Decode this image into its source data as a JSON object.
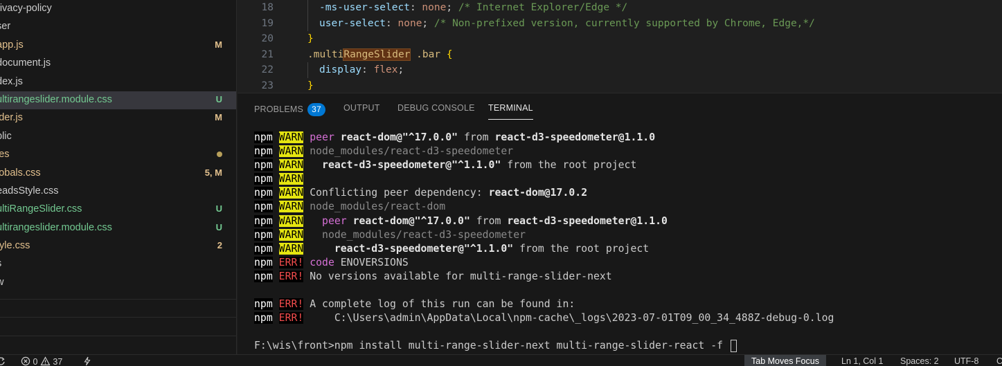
{
  "explorer": {
    "files": [
      {
        "name": "rivacy-policy",
        "status": "",
        "type": "default"
      },
      {
        "name": "ser",
        "status": "",
        "type": "default"
      },
      {
        "name": "app.js",
        "status": "M",
        "type": "modified"
      },
      {
        "name": "document.js",
        "status": "",
        "type": "default"
      },
      {
        "name": "dex.js",
        "status": "",
        "type": "default"
      },
      {
        "name": "ultirangeslider.module.css",
        "status": "U",
        "type": "untracked",
        "selected": true
      },
      {
        "name": "ider.js",
        "status": "M",
        "type": "modified"
      },
      {
        "name": "blic",
        "status": "",
        "type": "default"
      },
      {
        "name": "les",
        "status": "",
        "type": "modified",
        "dot": true
      },
      {
        "name": "lobals.css",
        "status": "5, M",
        "type": "modified"
      },
      {
        "name": "eadsStyle.css",
        "status": "",
        "type": "default"
      },
      {
        "name": "ultiRangeSlider.css",
        "status": "U",
        "type": "untracked"
      },
      {
        "name": "ultirangeslider.module.css",
        "status": "U",
        "type": "untracked"
      },
      {
        "name": "tyle.css",
        "status": "2",
        "type": "modified"
      },
      {
        "name": "s",
        "status": "",
        "type": "default"
      },
      {
        "name": "w",
        "status": "",
        "type": "default"
      }
    ]
  },
  "editor": {
    "lines": [
      {
        "num": "18",
        "indent": 1,
        "tokens": [
          {
            "t": "-ms-user-select",
            "c": "prop"
          },
          {
            "t": ": ",
            "c": "punct"
          },
          {
            "t": "none",
            "c": "val"
          },
          {
            "t": "; ",
            "c": "punct"
          },
          {
            "t": "/* Internet Explorer/Edge */",
            "c": "com"
          }
        ]
      },
      {
        "num": "19",
        "indent": 1,
        "tokens": [
          {
            "t": "user-select",
            "c": "prop"
          },
          {
            "t": ": ",
            "c": "punct"
          },
          {
            "t": "none",
            "c": "val"
          },
          {
            "t": "; ",
            "c": "punct"
          },
          {
            "t": "/* Non-prefixed version, currently supported by Chrome, Edge,*/",
            "c": "com"
          }
        ]
      },
      {
        "num": "20",
        "indent": 0,
        "tokens": [
          {
            "t": "}",
            "c": "brace"
          }
        ]
      },
      {
        "num": "21",
        "indent": 0,
        "tokens": [
          {
            "t": ".multi",
            "c": "sel"
          },
          {
            "t": "RangeSlider",
            "c": "sel",
            "hl": true
          },
          {
            "t": " .bar ",
            "c": "sel"
          },
          {
            "t": "{",
            "c": "brace"
          }
        ]
      },
      {
        "num": "22",
        "indent": 1,
        "tokens": [
          {
            "t": "display",
            "c": "prop"
          },
          {
            "t": ": ",
            "c": "punct"
          },
          {
            "t": "flex",
            "c": "val"
          },
          {
            "t": ";",
            "c": "punct"
          }
        ]
      },
      {
        "num": "23",
        "indent": 0,
        "tokens": [
          {
            "t": "}",
            "c": "brace"
          }
        ]
      }
    ]
  },
  "panel": {
    "tabs": [
      {
        "label": "PROBLEMS",
        "badge": "37",
        "active": false
      },
      {
        "label": "OUTPUT",
        "active": false
      },
      {
        "label": "DEBUG CONSOLE",
        "active": false
      },
      {
        "label": "TERMINAL",
        "active": true
      }
    ]
  },
  "terminal": {
    "lines": [
      [
        {
          "t": "npm",
          "c": "npm"
        },
        {
          "t": " "
        },
        {
          "t": "WARN",
          "c": "warn"
        },
        {
          "t": " "
        },
        {
          "t": "peer",
          "c": "peer"
        },
        {
          "t": " "
        },
        {
          "t": "react-dom@\"^17.0.0\"",
          "c": "b"
        },
        {
          "t": " from "
        },
        {
          "t": "react-d3-speedometer@1.1.0",
          "c": "b"
        }
      ],
      [
        {
          "t": "npm",
          "c": "npm"
        },
        {
          "t": " "
        },
        {
          "t": "WARN",
          "c": "warn"
        },
        {
          "t": " "
        },
        {
          "t": "node_modules/react-d3-speedometer",
          "c": "dim"
        }
      ],
      [
        {
          "t": "npm",
          "c": "npm"
        },
        {
          "t": " "
        },
        {
          "t": "WARN",
          "c": "warn"
        },
        {
          "t": "   "
        },
        {
          "t": "react-d3-speedometer@\"^1.1.0\"",
          "c": "b"
        },
        {
          "t": " from the root project"
        }
      ],
      [
        {
          "t": "npm",
          "c": "npm"
        },
        {
          "t": " "
        },
        {
          "t": "WARN",
          "c": "warn"
        }
      ],
      [
        {
          "t": "npm",
          "c": "npm"
        },
        {
          "t": " "
        },
        {
          "t": "WARN",
          "c": "warn"
        },
        {
          "t": " Conflicting peer dependency: "
        },
        {
          "t": "react-dom@17.0.2",
          "c": "b"
        }
      ],
      [
        {
          "t": "npm",
          "c": "npm"
        },
        {
          "t": " "
        },
        {
          "t": "WARN",
          "c": "warn"
        },
        {
          "t": " "
        },
        {
          "t": "node_modules/react-dom",
          "c": "dim"
        }
      ],
      [
        {
          "t": "npm",
          "c": "npm"
        },
        {
          "t": " "
        },
        {
          "t": "WARN",
          "c": "warn"
        },
        {
          "t": "   "
        },
        {
          "t": "peer",
          "c": "peer"
        },
        {
          "t": " "
        },
        {
          "t": "react-dom@\"^17.0.0\"",
          "c": "b"
        },
        {
          "t": " from "
        },
        {
          "t": "react-d3-speedometer@1.1.0",
          "c": "b"
        }
      ],
      [
        {
          "t": "npm",
          "c": "npm"
        },
        {
          "t": " "
        },
        {
          "t": "WARN",
          "c": "warn"
        },
        {
          "t": "   "
        },
        {
          "t": "node_modules/react-d3-speedometer",
          "c": "dim"
        }
      ],
      [
        {
          "t": "npm",
          "c": "npm"
        },
        {
          "t": " "
        },
        {
          "t": "WARN",
          "c": "warn"
        },
        {
          "t": "     "
        },
        {
          "t": "react-d3-speedometer@\"^1.1.0\"",
          "c": "b"
        },
        {
          "t": " from the root project"
        }
      ],
      [
        {
          "t": "npm",
          "c": "npm"
        },
        {
          "t": " "
        },
        {
          "t": "ERR!",
          "c": "err"
        },
        {
          "t": " "
        },
        {
          "t": "code",
          "c": "peer"
        },
        {
          "t": " ENOVERSIONS"
        }
      ],
      [
        {
          "t": "npm",
          "c": "npm"
        },
        {
          "t": " "
        },
        {
          "t": "ERR!",
          "c": "err"
        },
        {
          "t": " No versions available for multi-range-slider-next"
        }
      ],
      [],
      [
        {
          "t": "npm",
          "c": "npm"
        },
        {
          "t": " "
        },
        {
          "t": "ERR!",
          "c": "err"
        },
        {
          "t": " A complete log of this run can be found in:"
        }
      ],
      [
        {
          "t": "npm",
          "c": "npm"
        },
        {
          "t": " "
        },
        {
          "t": "ERR!",
          "c": "err"
        },
        {
          "t": "     C:\\Users\\admin\\AppData\\Local\\npm-cache\\_logs\\2023-07-01T09_00_34_488Z-debug-0.log"
        }
      ],
      [],
      [
        {
          "t": "F:\\wis\\front>npm install multi-range-slider-next multi-range-slider-react -f "
        },
        {
          "t": "",
          "c": "cursor"
        }
      ]
    ]
  },
  "statusbar": {
    "errors": "0",
    "warnings": "37",
    "focus_mode": "Tab Moves Focus",
    "position": "Ln 1, Col 1",
    "spaces": "Spaces: 2",
    "encoding": "UTF-8",
    "eol": "C"
  }
}
